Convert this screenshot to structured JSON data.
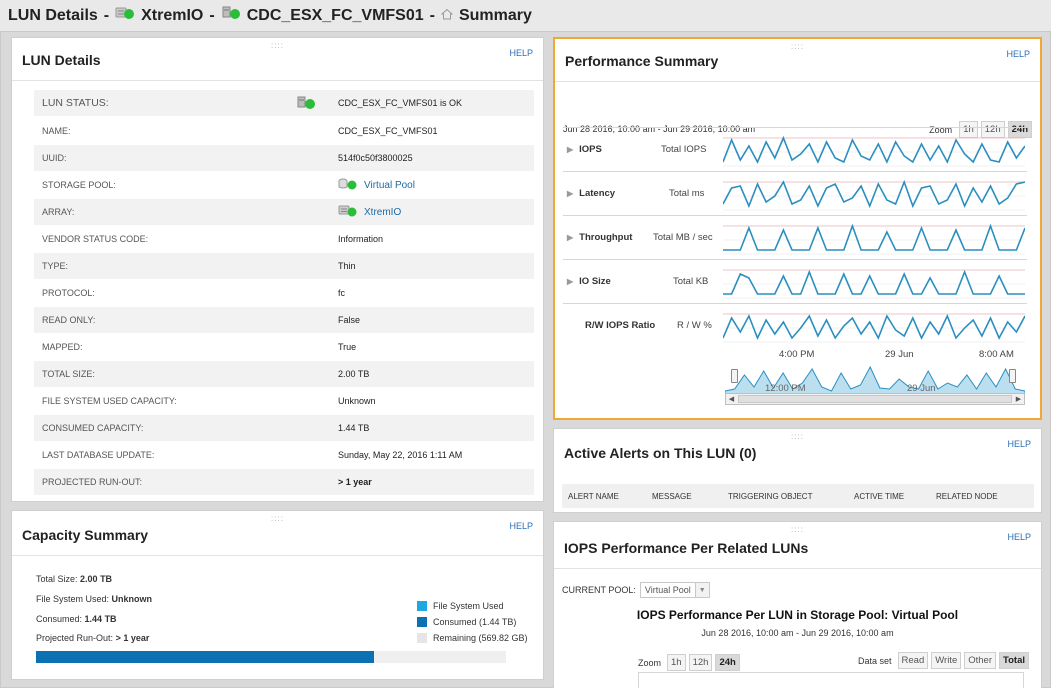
{
  "breadcrumb": {
    "part1": "LUN Details",
    "part2": "XtremIO",
    "part3": "CDC_ESX_FC_VMFS01",
    "part4": "Summary",
    "separator": "-"
  },
  "common": {
    "help": "HELP",
    "grip": "::::"
  },
  "lun_details": {
    "title": "LUN Details",
    "rows": [
      {
        "label": "LUN STATUS:",
        "value": "CDC_ESX_FC_VMFS01 is OK",
        "icon": "lun-status-ok-icon"
      },
      {
        "label": "NAME:",
        "value": "CDC_ESX_FC_VMFS01"
      },
      {
        "label": "UUID:",
        "value": "514f0c50f3800025"
      },
      {
        "label": "STORAGE POOL:",
        "value": "Virtual Pool",
        "icon": "storage-pool-icon"
      },
      {
        "label": "ARRAY:",
        "value": "XtremIO",
        "icon": "array-icon"
      },
      {
        "label": "VENDOR STATUS CODE:",
        "value": "Information"
      },
      {
        "label": "TYPE:",
        "value": "Thin"
      },
      {
        "label": "PROTOCOL:",
        "value": "fc"
      },
      {
        "label": "READ ONLY:",
        "value": "False"
      },
      {
        "label": "MAPPED:",
        "value": "True"
      },
      {
        "label": "TOTAL SIZE:",
        "value": "2.00 TB"
      },
      {
        "label": "FILE SYSTEM USED CAPACITY:",
        "value": "Unknown"
      },
      {
        "label": "CONSUMED CAPACITY:",
        "value": "1.44 TB"
      },
      {
        "label": "LAST DATABASE UPDATE:",
        "value": "Sunday, May 22, 2016 1:11 AM"
      },
      {
        "label": "PROJECTED RUN-OUT:",
        "value": "> 1 year"
      }
    ]
  },
  "capacity": {
    "title": "Capacity Summary",
    "total_label": "Total Size:",
    "total_value": "2.00 TB",
    "fs_label": "File System Used:",
    "fs_value": "Unknown",
    "consumed_label": "Consumed:",
    "consumed_value": "1.44 TB",
    "runout_label": "Projected Run-Out:",
    "runout_value": "> 1 year",
    "legend_fs": "File System Used",
    "legend_consumed": "Consumed (1.44 TB)",
    "legend_remaining": "Remaining (569.82 GB)",
    "consumed_fraction": 0.72,
    "colors": {
      "fs": "#1ea7e4",
      "consumed": "#0b71b3",
      "remaining": "#e5e5e5"
    }
  },
  "performance": {
    "title": "Performance Summary",
    "range": "Jun 28 2016, 10:00 am - Jun 29 2016, 10:00 am",
    "zoom_label": "Zoom",
    "zoom_options": [
      "1h",
      "12h",
      "24h"
    ],
    "zoom_selected": "24h",
    "axis_ticks": [
      "4:00 PM",
      "29 Jun",
      "8:00 AM"
    ],
    "navigator_ticks": [
      "12:00 PM",
      "29 Jun"
    ],
    "rows": [
      {
        "name": "IOPS",
        "unit": "Total IOPS",
        "expandable": true
      },
      {
        "name": "Latency",
        "unit": "Total ms",
        "expandable": true
      },
      {
        "name": "Throughput",
        "unit": "Total MB / sec",
        "expandable": true
      },
      {
        "name": "IO Size",
        "unit": "Total KB",
        "expandable": true
      },
      {
        "name": "R/W IOPS Ratio",
        "unit": "R / W %",
        "expandable": false
      }
    ],
    "line_color": "#2a8fc0",
    "highlight_color": "#f0a830"
  },
  "alerts": {
    "title": "Active Alerts on This LUN (0)",
    "columns": [
      "ALERT NAME",
      "MESSAGE",
      "TRIGGERING OBJECT",
      "ACTIVE TIME",
      "RELATED NODE"
    ]
  },
  "iops_luns": {
    "title": "IOPS Performance Per Related LUNs",
    "pool_label": "CURRENT POOL:",
    "pool_value": "Virtual Pool",
    "chart_title": "IOPS Performance Per LUN in Storage Pool: Virtual Pool",
    "chart_range": "Jun 28 2016, 10:00 am - Jun 29 2016, 10:00 am",
    "zoom_label": "Zoom",
    "zoom_options": [
      "1h",
      "12h",
      "24h"
    ],
    "zoom_selected": "24h",
    "dataset_label": "Data set",
    "dataset_options": [
      "Read",
      "Write",
      "Other",
      "Total"
    ],
    "dataset_selected": "Total"
  }
}
